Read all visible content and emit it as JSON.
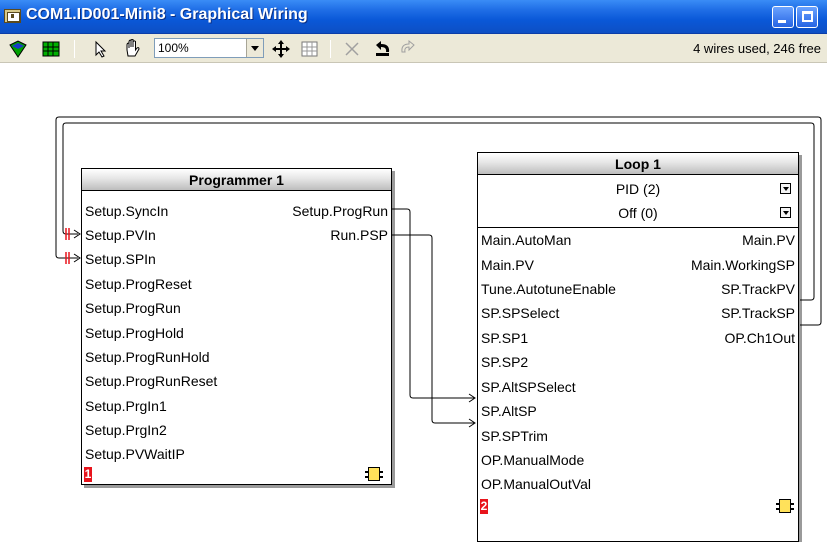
{
  "window": {
    "title": "COM1.ID001-Mini8 - Graphical Wiring"
  },
  "toolbar": {
    "zoom_value": "100%",
    "wire_status": "4 wires used, 246 free",
    "icons": [
      "palette-icon",
      "grid-block-icon",
      "select-arrow-icon",
      "pan-hand-icon",
      "move-icon",
      "fit-grid-icon",
      "delete-icon",
      "undo-icon",
      "redo-icon"
    ]
  },
  "blocks": {
    "programmer": {
      "title": "Programmer 1",
      "number": "1",
      "inputs": [
        "Setup.SyncIn",
        "Setup.PVIn",
        "Setup.SPIn",
        "Setup.ProgReset",
        "Setup.ProgRun",
        "Setup.ProgHold",
        "Setup.ProgRunHold",
        "Setup.ProgRunReset",
        "Setup.PrgIn1",
        "Setup.PrgIn2",
        "Setup.PVWaitIP"
      ],
      "outputs": [
        "Setup.ProgRun",
        "Run.PSP"
      ]
    },
    "loop": {
      "title": "Loop 1",
      "number": "2",
      "modes": [
        "PID (2)",
        "Off (0)"
      ],
      "inputs": [
        "Main.AutoMan",
        "Main.PV",
        "Tune.AutotuneEnable",
        "SP.SPSelect",
        "SP.SP1",
        "SP.SP2",
        "SP.AltSPSelect",
        "SP.AltSP",
        "SP.SPTrim",
        "OP.ManualMode",
        "OP.ManualOutVal"
      ],
      "outputs": [
        "Main.PV",
        "Main.WorkingSP",
        "SP.TrackPV",
        "SP.TrackSP",
        "OP.Ch1Out"
      ]
    }
  },
  "colors": {
    "titlebar": "#0a58d8",
    "wire": "#000000",
    "block_number": "#e8141c",
    "block_icon": "#ffe15a",
    "feedback_marker": "#e8141c"
  }
}
